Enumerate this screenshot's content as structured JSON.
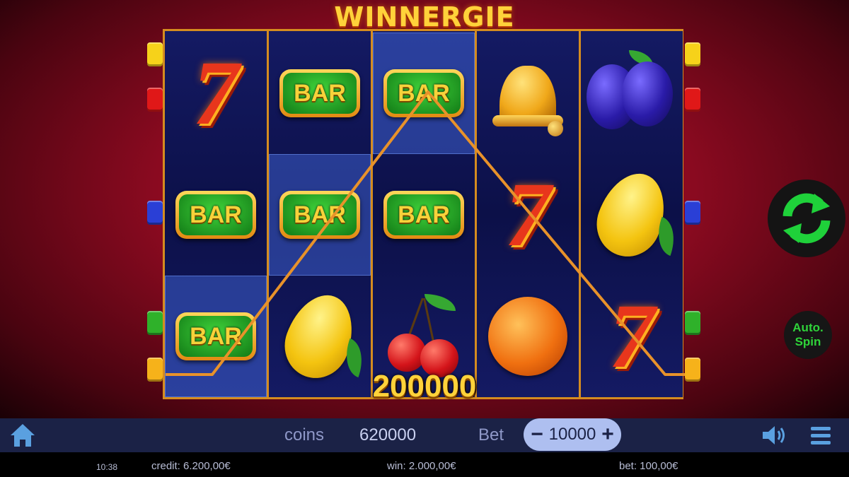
{
  "game": {
    "title": "WINNERGIE"
  },
  "win_amount": "200000",
  "reels": [
    [
      "seven",
      "bar",
      "bar"
    ],
    [
      "bar",
      "bar",
      "lemon"
    ],
    [
      "bar",
      "bar",
      "cherries"
    ],
    [
      "bell",
      "seven",
      "orange"
    ],
    [
      "plum",
      "lemon",
      "seven"
    ]
  ],
  "symbol_labels": {
    "bar": "BAR",
    "seven": "7"
  },
  "winning_cells": [
    [
      0,
      2
    ],
    [
      1,
      1
    ],
    [
      2,
      0
    ]
  ],
  "paylines_left": [
    "#f6d21a",
    "#e01818",
    "#2a3fd6",
    "#2fb12a",
    "#f6b21a"
  ],
  "paylines_right": [
    "#f6d21a",
    "#e01818",
    "#2a3fd6",
    "#2fb12a",
    "#f6b21a"
  ],
  "buttons": {
    "spin": {
      "icon": "refresh-icon",
      "color": "#1fd13a"
    },
    "autospin": {
      "label_line1": "Auto.",
      "label_line2": "Spin"
    }
  },
  "toolbar": {
    "home_icon": "home-icon",
    "coins_label": "coins",
    "coins_value": "620000",
    "bet_label": "Bet",
    "bet_value": "10000",
    "bet_minus": "−",
    "bet_plus": "+",
    "sound_icon": "speaker-icon",
    "menu_icon": "hamburger-menu-icon"
  },
  "status": {
    "time": "10:38",
    "credit": "credit: 6.200,00€",
    "win": "win: 2.000,00€",
    "bet": "bet: 100,00€"
  },
  "colors": {
    "frame": "#d58c1f",
    "win_line": "#e8922a",
    "accent_green": "#1fd13a"
  }
}
